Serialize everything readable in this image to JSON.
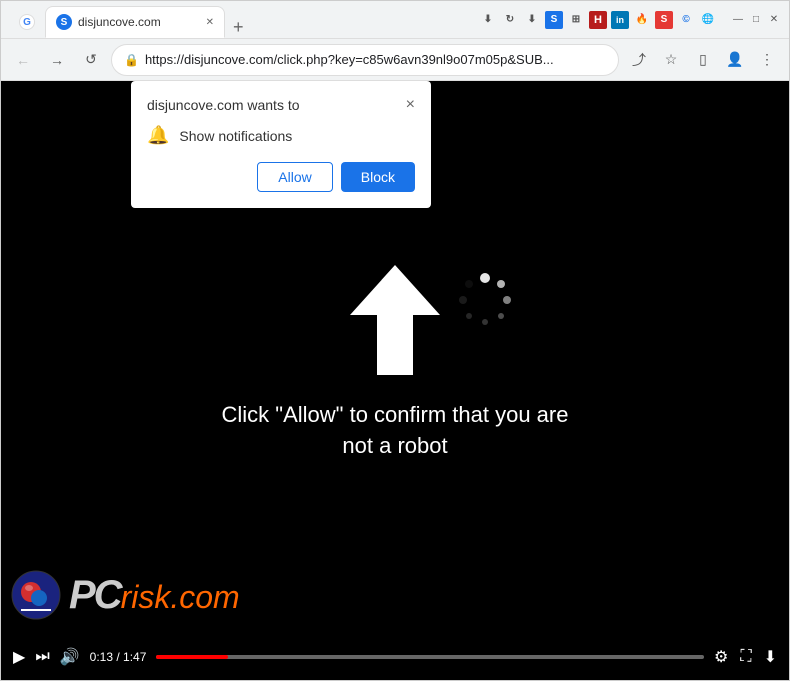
{
  "browser": {
    "tabs": [
      {
        "favicon_type": "G",
        "label": "Google",
        "active": false
      },
      {
        "favicon_type": "S",
        "label": "disjuncove.com",
        "active": true
      }
    ],
    "tab_new_label": "+",
    "window_controls": [
      "—",
      "□",
      "×"
    ],
    "url": "https://disjuncove.com/click.php?key=c85w6avn39nl9o07m05p&SUB...",
    "nav": {
      "back": "←",
      "forward": "→",
      "reload": "↺"
    }
  },
  "popup": {
    "title": "disjuncove.com wants to",
    "close_label": "×",
    "notification_icon": "🔔",
    "notification_text": "Show notifications",
    "allow_label": "Allow",
    "block_label": "Block"
  },
  "video": {
    "captcha_text": "Click \"Allow\" to confirm that you are not a robot",
    "time_current": "0:13",
    "time_total": "1:47",
    "controls": {
      "play": "▶",
      "skip": "⏭",
      "volume": "🔊",
      "settings": "⚙",
      "fullscreen": "⛶",
      "download": "⬇"
    }
  },
  "brand": {
    "text_white": "PC",
    "text_separator": "·",
    "text_orange": "risk.com"
  }
}
